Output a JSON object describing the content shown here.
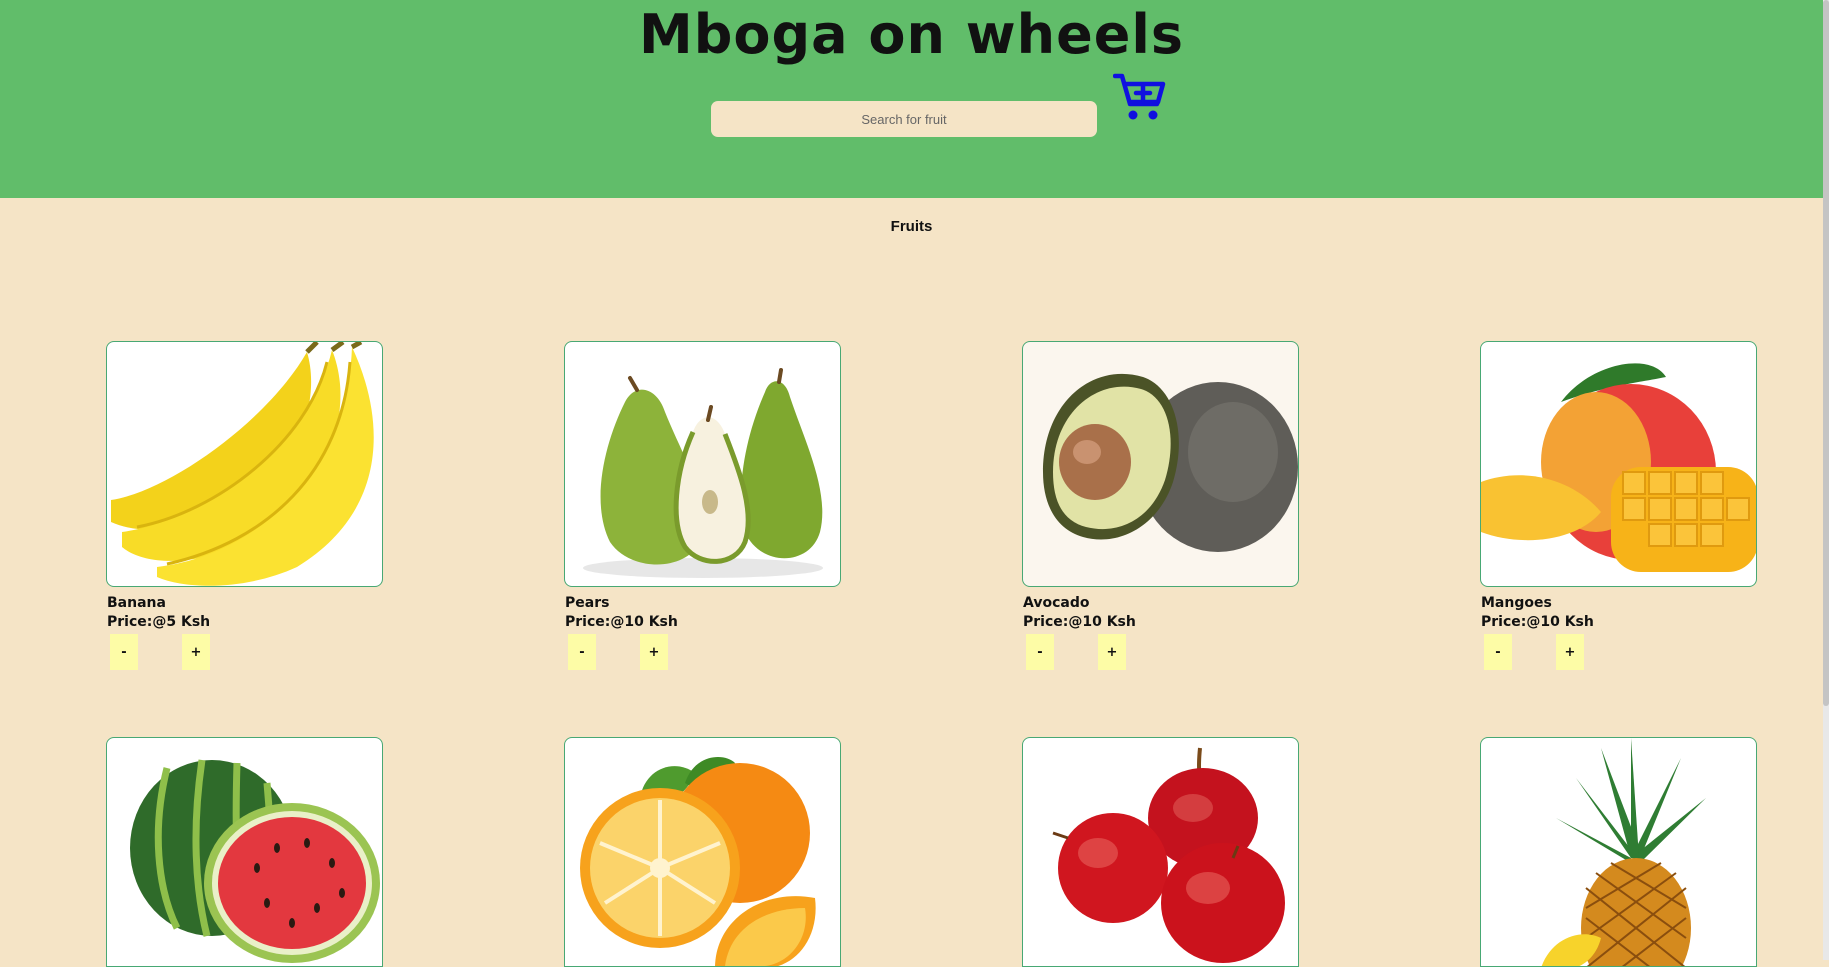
{
  "header": {
    "title": "Mboga on wheels",
    "search_placeholder": "Search for fruit",
    "cart_icon": "add-to-cart-icon"
  },
  "colors": {
    "header_bg": "#61bd6a",
    "page_bg": "#f5e4c6",
    "button_bg": "#fdfca6",
    "card_border": "#48a874",
    "cart_icon": "#1010e0"
  },
  "section": {
    "title": "Fruits"
  },
  "products": [
    {
      "name": "Banana",
      "price": "Price:@5 Ksh",
      "minus": "-",
      "plus": "+",
      "qty": ""
    },
    {
      "name": "Pears",
      "price": "Price:@10 Ksh",
      "minus": "-",
      "plus": "+",
      "qty": ""
    },
    {
      "name": "Avocado",
      "price": "Price:@10 Ksh",
      "minus": "-",
      "plus": "+",
      "qty": ""
    },
    {
      "name": "Mangoes",
      "price": "Price:@10 Ksh",
      "minus": "-",
      "plus": "+",
      "qty": ""
    },
    {
      "image": "watermelon"
    },
    {
      "image": "orange"
    },
    {
      "image": "apple"
    },
    {
      "image": "pineapple"
    }
  ]
}
